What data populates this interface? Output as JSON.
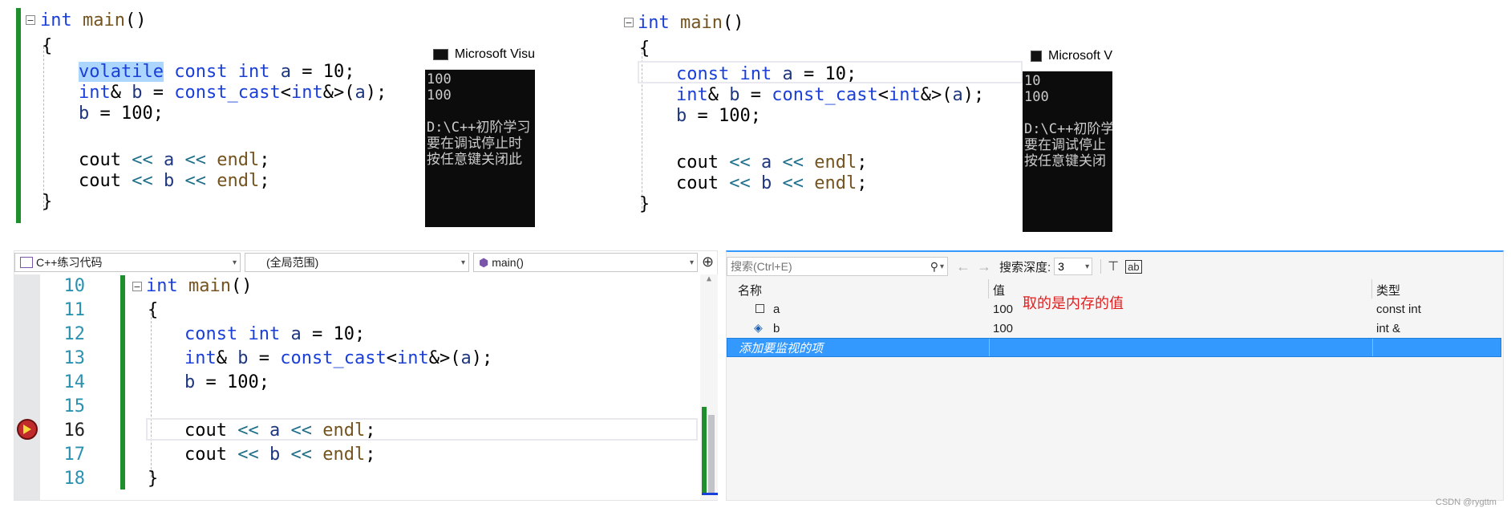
{
  "top_left": {
    "code_lines": [
      {
        "parts": [
          {
            "t": "int",
            "c": "kw"
          },
          {
            "t": " "
          },
          {
            "t": "main",
            "c": "fn"
          },
          {
            "t": "()"
          }
        ]
      },
      {
        "parts": [
          {
            "t": "{"
          }
        ]
      },
      {
        "parts": [
          {
            "t": "volatile",
            "c": "kw sel"
          },
          {
            "t": " "
          },
          {
            "t": "const",
            "c": "kw"
          },
          {
            "t": " "
          },
          {
            "t": "int",
            "c": "kw"
          },
          {
            "t": " "
          },
          {
            "t": "a",
            "c": "var"
          },
          {
            "t": " = "
          },
          {
            "t": "10"
          },
          {
            "t": ";"
          }
        ]
      },
      {
        "parts": [
          {
            "t": "int",
            "c": "kw"
          },
          {
            "t": "& "
          },
          {
            "t": "b",
            "c": "var"
          },
          {
            "t": " = "
          },
          {
            "t": "const_cast",
            "c": "kw"
          },
          {
            "t": "<"
          },
          {
            "t": "int",
            "c": "kw"
          },
          {
            "t": "&>("
          },
          {
            "t": "a",
            "c": "var"
          },
          {
            "t": ");"
          }
        ]
      },
      {
        "parts": [
          {
            "t": "b",
            "c": "var"
          },
          {
            "t": " = 100;"
          }
        ]
      },
      {
        "parts": [
          {
            "t": ""
          }
        ]
      },
      {
        "parts": [
          {
            "t": "cout"
          },
          {
            "t": " << ",
            "c": "op"
          },
          {
            "t": "a",
            "c": "var"
          },
          {
            "t": " << ",
            "c": "op"
          },
          {
            "t": "endl",
            "c": "fn"
          },
          {
            "t": ";"
          }
        ]
      },
      {
        "parts": [
          {
            "t": "cout"
          },
          {
            "t": " << ",
            "c": "op"
          },
          {
            "t": "b",
            "c": "var"
          },
          {
            "t": " << ",
            "c": "op"
          },
          {
            "t": "endl",
            "c": "fn"
          },
          {
            "t": ";"
          }
        ]
      },
      {
        "parts": [
          {
            "t": "}"
          }
        ]
      }
    ],
    "console_title": "Microsoft Visu",
    "console_lines": [
      "100",
      "100",
      "",
      "D:\\C++初阶学习",
      "要在调试停止时",
      "按任意键关闭此"
    ]
  },
  "top_right": {
    "code_lines": [
      {
        "parts": [
          {
            "t": "int",
            "c": "kw"
          },
          {
            "t": " "
          },
          {
            "t": "main",
            "c": "fn"
          },
          {
            "t": "()"
          }
        ]
      },
      {
        "parts": [
          {
            "t": "{"
          }
        ]
      },
      {
        "parts": [
          {
            "t": "const",
            "c": "kw"
          },
          {
            "t": " "
          },
          {
            "t": "int",
            "c": "kw"
          },
          {
            "t": " "
          },
          {
            "t": "a",
            "c": "var"
          },
          {
            "t": " = "
          },
          {
            "t": "10"
          },
          {
            "t": ";"
          }
        ]
      },
      {
        "parts": [
          {
            "t": "int",
            "c": "kw"
          },
          {
            "t": "& "
          },
          {
            "t": "b",
            "c": "var"
          },
          {
            "t": " = "
          },
          {
            "t": "const_cast",
            "c": "kw"
          },
          {
            "t": "<"
          },
          {
            "t": "int",
            "c": "kw"
          },
          {
            "t": "&>("
          },
          {
            "t": "a",
            "c": "var"
          },
          {
            "t": ");"
          }
        ]
      },
      {
        "parts": [
          {
            "t": "b",
            "c": "var"
          },
          {
            "t": " = 100;"
          }
        ]
      },
      {
        "parts": [
          {
            "t": ""
          }
        ]
      },
      {
        "parts": [
          {
            "t": "cout"
          },
          {
            "t": " << ",
            "c": "op"
          },
          {
            "t": "a",
            "c": "var"
          },
          {
            "t": " << ",
            "c": "op"
          },
          {
            "t": "endl",
            "c": "fn"
          },
          {
            "t": ";"
          }
        ]
      },
      {
        "parts": [
          {
            "t": "cout"
          },
          {
            "t": " << ",
            "c": "op"
          },
          {
            "t": "b",
            "c": "var"
          },
          {
            "t": " << ",
            "c": "op"
          },
          {
            "t": "endl",
            "c": "fn"
          },
          {
            "t": ";"
          }
        ]
      },
      {
        "parts": [
          {
            "t": "}"
          }
        ]
      }
    ],
    "console_title": "Microsoft V",
    "console_lines": [
      "10",
      "100",
      "",
      "D:\\C++初阶学",
      "要在调试停止",
      "按任意键关闭"
    ]
  },
  "editor": {
    "project_dropdown": "C++练习代码",
    "scope_dropdown": "(全局范围)",
    "function_dropdown": "main()",
    "line_numbers": [
      "10",
      "11",
      "12",
      "13",
      "14",
      "15",
      "16",
      "17",
      "18"
    ],
    "current_line": "16",
    "code_lines": [
      {
        "parts": [
          {
            "t": "int",
            "c": "kw"
          },
          {
            "t": " "
          },
          {
            "t": "main",
            "c": "fn"
          },
          {
            "t": "()"
          }
        ]
      },
      {
        "parts": [
          {
            "t": "{"
          }
        ]
      },
      {
        "parts": [
          {
            "t": "const",
            "c": "kw"
          },
          {
            "t": " "
          },
          {
            "t": "int",
            "c": "kw"
          },
          {
            "t": " "
          },
          {
            "t": "a",
            "c": "var"
          },
          {
            "t": " = "
          },
          {
            "t": "10"
          },
          {
            "t": ";"
          }
        ]
      },
      {
        "parts": [
          {
            "t": "int",
            "c": "kw"
          },
          {
            "t": "& "
          },
          {
            "t": "b",
            "c": "var"
          },
          {
            "t": " = "
          },
          {
            "t": "const_cast",
            "c": "kw"
          },
          {
            "t": "<"
          },
          {
            "t": "int",
            "c": "kw"
          },
          {
            "t": "&>("
          },
          {
            "t": "a",
            "c": "var"
          },
          {
            "t": ");"
          }
        ]
      },
      {
        "parts": [
          {
            "t": "b",
            "c": "var"
          },
          {
            "t": " = 100;"
          }
        ]
      },
      {
        "parts": [
          {
            "t": ""
          }
        ]
      },
      {
        "parts": [
          {
            "t": "cout"
          },
          {
            "t": " << ",
            "c": "op"
          },
          {
            "t": "a",
            "c": "var"
          },
          {
            "t": " << ",
            "c": "op"
          },
          {
            "t": "endl",
            "c": "fn"
          },
          {
            "t": ";"
          }
        ]
      },
      {
        "parts": [
          {
            "t": "cout"
          },
          {
            "t": " << ",
            "c": "op"
          },
          {
            "t": "b",
            "c": "var"
          },
          {
            "t": " << ",
            "c": "op"
          },
          {
            "t": "endl",
            "c": "fn"
          },
          {
            "t": ";"
          }
        ]
      },
      {
        "parts": [
          {
            "t": "}"
          }
        ]
      }
    ]
  },
  "watch": {
    "search_placeholder": "搜索(Ctrl+E)",
    "depth_label": "搜索深度:",
    "depth_value": "3",
    "col_name": "名称",
    "col_value": "值",
    "col_type": "类型",
    "annotation": "取的是内存的值",
    "rows": [
      {
        "name": "a",
        "value": "100",
        "type": "const int",
        "icon": "variable-icon"
      },
      {
        "name": "b",
        "value": "100",
        "type": "int &",
        "icon": "reference-icon"
      }
    ],
    "add_item": "添加要监视的项"
  },
  "watermark": "CSDN @rygttm",
  "colors": {
    "accent": "#3399ff",
    "change_bar": "#1f8f2e",
    "annotation": "#e02020"
  }
}
